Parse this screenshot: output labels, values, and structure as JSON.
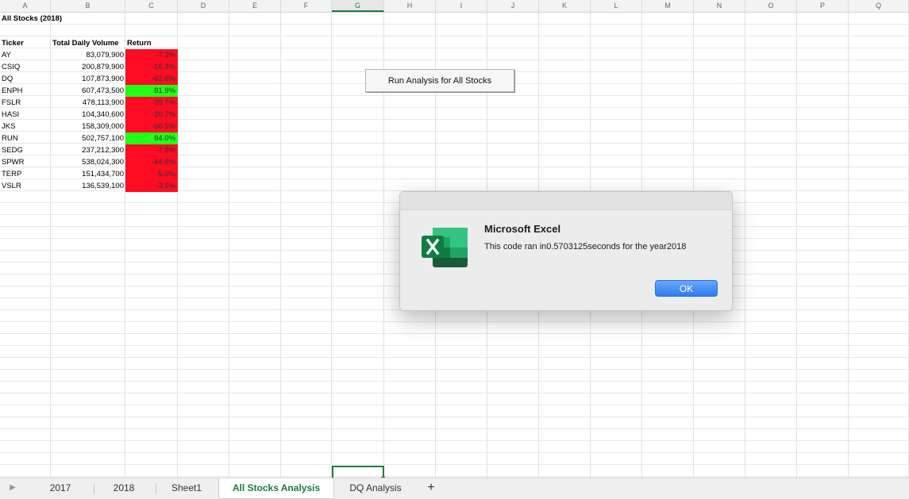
{
  "columns": [
    "A",
    "B",
    "C",
    "D",
    "E",
    "F",
    "G",
    "H",
    "I",
    "J",
    "K",
    "L",
    "M",
    "N",
    "O",
    "P",
    "Q"
  ],
  "selected_column": "G",
  "sheet": {
    "title": "All Stocks (2018)",
    "headers": [
      "Ticker",
      "Total Daily Volume",
      "Return"
    ],
    "rows": [
      {
        "ticker": "AY",
        "volume": "83,079,900",
        "ret": "-7.3%",
        "status": "negative"
      },
      {
        "ticker": "CSIQ",
        "volume": "200,879,900",
        "ret": "-16.3%",
        "status": "negative"
      },
      {
        "ticker": "DQ",
        "volume": "107,873,900",
        "ret": "-62.6%",
        "status": "negative"
      },
      {
        "ticker": "ENPH",
        "volume": "607,473,500",
        "ret": "81.9%",
        "status": "positive"
      },
      {
        "ticker": "FSLR",
        "volume": "478,113,900",
        "ret": "-39.7%",
        "status": "negative"
      },
      {
        "ticker": "HASI",
        "volume": "104,340,600",
        "ret": "-20.7%",
        "status": "negative"
      },
      {
        "ticker": "JKS",
        "volume": "158,309,000",
        "ret": "-60.5%",
        "status": "negative"
      },
      {
        "ticker": "RUN",
        "volume": "502,757,100",
        "ret": "84.0%",
        "status": "positive"
      },
      {
        "ticker": "SEDG",
        "volume": "237,212,300",
        "ret": "-7.8%",
        "status": "negative"
      },
      {
        "ticker": "SPWR",
        "volume": "538,024,300",
        "ret": "-44.6%",
        "status": "negative"
      },
      {
        "ticker": "TERP",
        "volume": "151,434,700",
        "ret": "-5.0%",
        "status": "negative"
      },
      {
        "ticker": "VSLR",
        "volume": "136,539,100",
        "ret": "-3.5%",
        "status": "negative"
      }
    ]
  },
  "button": {
    "label": "Run Analysis for All Stocks"
  },
  "dialog": {
    "title": "Microsoft Excel",
    "message": "This code ran in0.5703125seconds for the year2018",
    "ok_label": "OK",
    "icon": "excel-app-icon"
  },
  "tabs": [
    {
      "label": "2017",
      "active": false
    },
    {
      "label": "2018",
      "active": false
    },
    {
      "label": "Sheet1",
      "active": false
    },
    {
      "label": "All Stocks Analysis",
      "active": true
    },
    {
      "label": "DQ Analysis",
      "active": false
    }
  ],
  "add_sheet_label": "+",
  "colors": {
    "positive": "#21ff16",
    "negative": "#fe0b24",
    "accent": "#1f7a3d",
    "ok_button": "#2f7cf0"
  }
}
